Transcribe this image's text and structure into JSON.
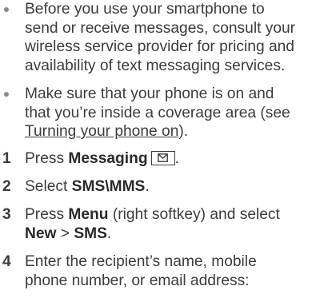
{
  "bullets": [
    {
      "lines": [
        "Before you use your smartphone to",
        "send or receive messages, consult your",
        "wireless service provider for pricing and",
        "availability of text messaging services."
      ]
    },
    {
      "lines": [
        "Make sure that your phone is on and",
        "that you’re inside a coverage area (see"
      ],
      "link_text": "Turning your phone on",
      "link_suffix": ")."
    }
  ],
  "steps": [
    {
      "number": "1",
      "prefix": "Press ",
      "bold": "Messaging",
      "suffix": "."
    },
    {
      "number": "2",
      "prefix": "Select ",
      "bold": "SMS\\MMS",
      "suffix": "."
    },
    {
      "number": "3",
      "prefix": "Press ",
      "bold": "Menu",
      "middle": " (right softkey) and select",
      "line2_bold1": "New",
      "line2_sep": " > ",
      "line2_bold2": "SMS",
      "line2_suffix": "."
    },
    {
      "number": "4",
      "lines": [
        "Enter the recipient’s name, mobile",
        "phone number, or email address:"
      ]
    }
  ],
  "icons": {
    "messaging_key": "envelope-icon"
  }
}
